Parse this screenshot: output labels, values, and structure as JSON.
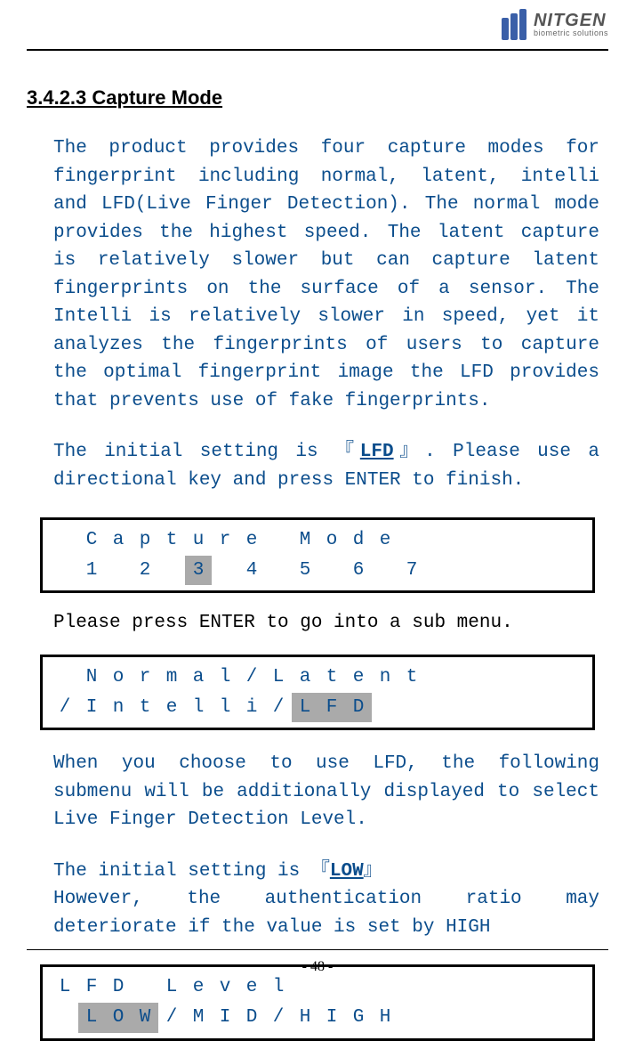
{
  "logo": {
    "main": "NITGEN",
    "sub": "biometric solutions"
  },
  "section": {
    "number_title": "3.4.2.3 Capture Mode"
  },
  "para1": "The product provides four capture modes for fingerprint including normal, latent, intelli and LFD(Live Finger Detection). The normal mode provides the highest speed. The latent capture is relatively slower but can capture latent fingerprints on the surface of a sensor. The Intelli is relatively slower in speed, yet it analyzes the fingerprints of users to capture the optimal fingerprint image the LFD provides that prevents use of fake fingerprints.",
  "para2_pre": "The initial setting is  『",
  "para2_emph": "LFD",
  "para2_post": "』. Please use a directional key and press ENTER to finish.",
  "lcd1": {
    "row1": [
      "",
      "C",
      "a",
      "p",
      "t",
      "u",
      "r",
      "e",
      "",
      "M",
      "o",
      "d",
      "e",
      "",
      "",
      ""
    ],
    "row2": {
      "cells": [
        "",
        "1",
        "",
        "2",
        "",
        "3",
        "",
        "4",
        "",
        "5",
        "",
        "6",
        "",
        "7",
        "",
        ""
      ],
      "selectedIndex": 5
    }
  },
  "instruction1": "Please press ENTER to go into a sub menu.",
  "lcd2": {
    "row1": [
      "",
      "N",
      "o",
      "r",
      "m",
      "a",
      "l",
      "/",
      "L",
      "a",
      "t",
      "e",
      "n",
      "t",
      "",
      ""
    ],
    "row2": {
      "cells": [
        "/",
        "I",
        "n",
        "t",
        "e",
        "l",
        "l",
        "i",
        "/",
        "L",
        "F",
        "D",
        "",
        "",
        "",
        ""
      ],
      "selectedRange": [
        9,
        11
      ]
    }
  },
  "para3": "When you choose to use LFD, the following submenu will be additionally displayed to select Live Finger Detection Level.",
  "para4_pre": "The initial setting is 『",
  "para4_emph": "LOW",
  "para4_post": "』",
  "para5": "However, the authentication ratio may deteriorate if the value is set by HIGH",
  "lcd3": {
    "row1": [
      "L",
      "F",
      "D",
      "",
      "L",
      "e",
      "v",
      "e",
      "l",
      "",
      "",
      "",
      "",
      "",
      "",
      ""
    ],
    "row2": {
      "cells": [
        "",
        "L",
        "O",
        "W",
        "/",
        "M",
        "I",
        "D",
        "/",
        "H",
        "I",
        "G",
        "H",
        "",
        "",
        ""
      ],
      "selectedRange": [
        1,
        3
      ]
    }
  },
  "page": "- 48 -"
}
